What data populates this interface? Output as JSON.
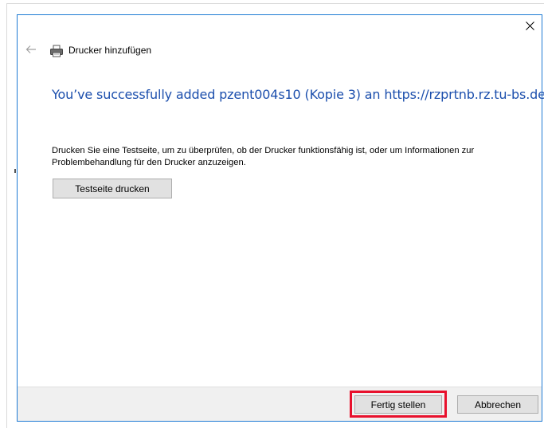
{
  "titlebar": {
    "close_icon": "close-icon"
  },
  "nav": {
    "back_icon": "back-arrow-icon",
    "printer_icon": "printer-icon",
    "title": "Drucker hinzufügen"
  },
  "main": {
    "heading": "You’ve successfully added pzent004s10 (Kopie 3) an https://rzprtnb.rz.tu-bs.de",
    "description": "Drucken Sie eine Testseite, um zu überprüfen, ob der Drucker funktionsfähig ist, oder um Informationen zur Problembehandlung für den Drucker anzuzeigen.",
    "test_page_button": "Testseite drucken"
  },
  "footer": {
    "finish_button": "Fertig stellen",
    "cancel_button": "Abbrechen"
  },
  "colors": {
    "heading_blue": "#1c4fad",
    "window_border": "#1e7bd4",
    "highlight_red": "#e8112d",
    "footer_bg": "#f0f0f0"
  }
}
